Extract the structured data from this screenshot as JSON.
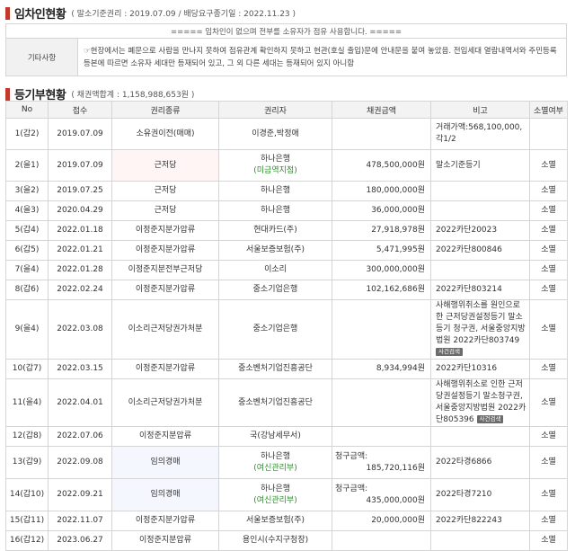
{
  "tenant_section": {
    "title": "임차인현황",
    "subtitle": "( 말소기준권리 : 2019.07.09 / 배당요구종기일 : 2022.11.23 )",
    "notice": "===== 임차인이 없으며 전부를 소유자가 점유 사용합니다. =====",
    "etc_label": "기타사항",
    "etc_text": "☞현장에서는 폐문으로 사람을 만나지 못하여 점유관계 확인하지 못하고 현관(호실 출입)문에 안내문을 붙여 놓았음. 전입세대 열람내역서와 주민등록등본에 따르면 소유자 세대만 등재되어 있고, 그 외 다른 세대는 등재되어 있지 아니함"
  },
  "registry_section": {
    "title": "등기부현황",
    "subtitle": "( 채권액합계 : 1,158,988,653원 )",
    "headers": [
      "No",
      "접수",
      "권리종류",
      "권리자",
      "채권금액",
      "비고",
      "소멸여부"
    ],
    "badge_label": "사건검색",
    "rows": [
      {
        "no": "1(갑2)",
        "date": "2019.07.09",
        "type": "소유권이전(매매)",
        "holder": "이경준,박정애",
        "holder_sub": "",
        "amount": "",
        "note": "거래가액:568,100,000,각1/2",
        "status": ""
      },
      {
        "no": "2(을1)",
        "date": "2019.07.09",
        "type": "근저당",
        "holder": "하나은행",
        "holder_sub": "(미금역지점)",
        "amount": "478,500,000원",
        "note": "말소기준등기",
        "status": "소멸"
      },
      {
        "no": "3(을2)",
        "date": "2019.07.25",
        "type": "근저당",
        "holder": "하나은행",
        "holder_sub": "",
        "amount": "180,000,000원",
        "note": "",
        "status": "소멸"
      },
      {
        "no": "4(을3)",
        "date": "2020.04.29",
        "type": "근저당",
        "holder": "하나은행",
        "holder_sub": "",
        "amount": "36,000,000원",
        "note": "",
        "status": "소멸"
      },
      {
        "no": "5(갑4)",
        "date": "2022.01.18",
        "type": "이정준지분가압류",
        "holder": "현대카드(주)",
        "holder_sub": "",
        "amount": "27,918,978원",
        "note": "2022카단20023",
        "status": "소멸"
      },
      {
        "no": "6(갑5)",
        "date": "2022.01.21",
        "type": "이정준지분가압류",
        "holder": "서울보증보험(주)",
        "holder_sub": "",
        "amount": "5,471,995원",
        "note": "2022카단800846",
        "status": "소멸"
      },
      {
        "no": "7(을4)",
        "date": "2022.01.28",
        "type": "이정준지분전부근저당",
        "holder": "이소리",
        "holder_sub": "",
        "amount": "300,000,000원",
        "note": "",
        "status": "소멸"
      },
      {
        "no": "8(갑6)",
        "date": "2022.02.24",
        "type": "이정준지분가압류",
        "holder": "중소기업은행",
        "holder_sub": "",
        "amount": "102,162,686원",
        "note": "2022카단803214",
        "status": "소멸"
      },
      {
        "no": "9(을4)",
        "date": "2022.03.08",
        "type": "이소리근저당권가처분",
        "holder": "중소기업은행",
        "holder_sub": "",
        "amount": "",
        "note": "사해행위취소를 원인으로 한 근저당권설정등기 말소등기 청구권, 서울중앙지방법원 2022카단803749",
        "status": "소멸"
      },
      {
        "no": "10(갑7)",
        "date": "2022.03.15",
        "type": "이정준지분가압류",
        "holder": "중소벤처기업진흥공단",
        "holder_sub": "",
        "amount": "8,934,994원",
        "note": "2022카단10316",
        "status": "소멸"
      },
      {
        "no": "11(을4)",
        "date": "2022.04.01",
        "type": "이소리근저당권가처분",
        "holder": "중소벤처기업진흥공단",
        "holder_sub": "",
        "amount": "",
        "note": "사해행위취소로 인한 근저당권설정등기 말소청구권, 서울중앙지방법원 2022카단805396",
        "status": "소멸"
      },
      {
        "no": "12(갑8)",
        "date": "2022.07.06",
        "type": "이정준지분압류",
        "holder": "국(강남세무서)",
        "holder_sub": "",
        "amount": "",
        "note": "",
        "status": "소멸"
      },
      {
        "no": "13(갑9)",
        "date": "2022.09.08",
        "type": "임의경매",
        "holder": "하나은행",
        "holder_sub": "(여신관리부)",
        "claim_label": "청구금액:",
        "amount": "185,720,116원",
        "note": "2022타경6866",
        "status": "소멸"
      },
      {
        "no": "14(갑10)",
        "date": "2022.09.21",
        "type": "임의경매",
        "holder": "하나은행",
        "holder_sub": "(여신관리부)",
        "claim_label": "청구금액:",
        "amount": "435,000,000원",
        "note": "2022타경7210",
        "status": "소멸"
      },
      {
        "no": "15(갑11)",
        "date": "2022.11.07",
        "type": "이정준지분가압류",
        "holder": "서울보증보험(주)",
        "holder_sub": "",
        "amount": "20,000,000원",
        "note": "2022카단822243",
        "status": "소멸"
      },
      {
        "no": "16(갑12)",
        "date": "2023.06.27",
        "type": "이정준지분압류",
        "holder": "용인시(수지구청장)",
        "holder_sub": "",
        "amount": "",
        "note": "",
        "status": "소멸"
      }
    ]
  }
}
